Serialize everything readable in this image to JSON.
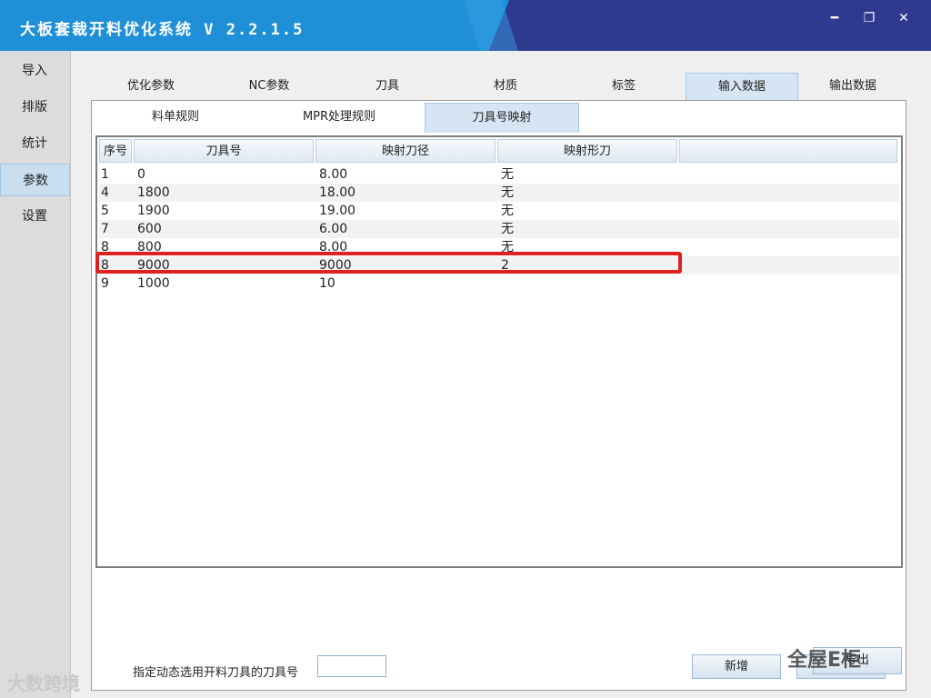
{
  "window": {
    "title": "大板套裁开料优化系统 V 2.2.1.5",
    "min_symbol": "━",
    "max_symbol": "❐",
    "close_symbol": "✕"
  },
  "sidebar": {
    "items": [
      {
        "label": "导入"
      },
      {
        "label": "排版"
      },
      {
        "label": "统计"
      },
      {
        "label": "参数",
        "active": true
      },
      {
        "label": "设置"
      }
    ]
  },
  "tabs": [
    {
      "label": "优化参数"
    },
    {
      "label": "NC参数"
    },
    {
      "label": "刀具"
    },
    {
      "label": "材质"
    },
    {
      "label": "标签"
    },
    {
      "label": "输入数据",
      "active": true
    },
    {
      "label": "输出数据"
    }
  ],
  "subtabs": [
    {
      "label": "料单规则"
    },
    {
      "label": "MPR处理规则"
    },
    {
      "label": "刀具号映射",
      "active": true
    }
  ],
  "table": {
    "columns": [
      "序号",
      "刀具号",
      "映射刀径",
      "映射形刀"
    ],
    "rows": [
      [
        "1",
        "0",
        "8.00",
        "无"
      ],
      [
        "4",
        "1800",
        "18.00",
        "无"
      ],
      [
        "5",
        "1900",
        "19.00",
        "无"
      ],
      [
        "7",
        "600",
        "6.00",
        "无"
      ],
      [
        "8",
        "800",
        "8.00",
        "无"
      ],
      [
        "8",
        "9000",
        "9000",
        "2"
      ],
      [
        "9",
        "1000",
        "10",
        ""
      ]
    ]
  },
  "bottom": {
    "label": "指定动态选用开料刀具的刀具号",
    "input_value": "",
    "add_label": "新增",
    "delete_label": "删除"
  },
  "extra_button": "导出",
  "watermark_left": "大数跨境",
  "watermark_right": "全屋E柜",
  "colors": {
    "highlight": "#e02020",
    "titlebar": "#1f8fd8"
  }
}
